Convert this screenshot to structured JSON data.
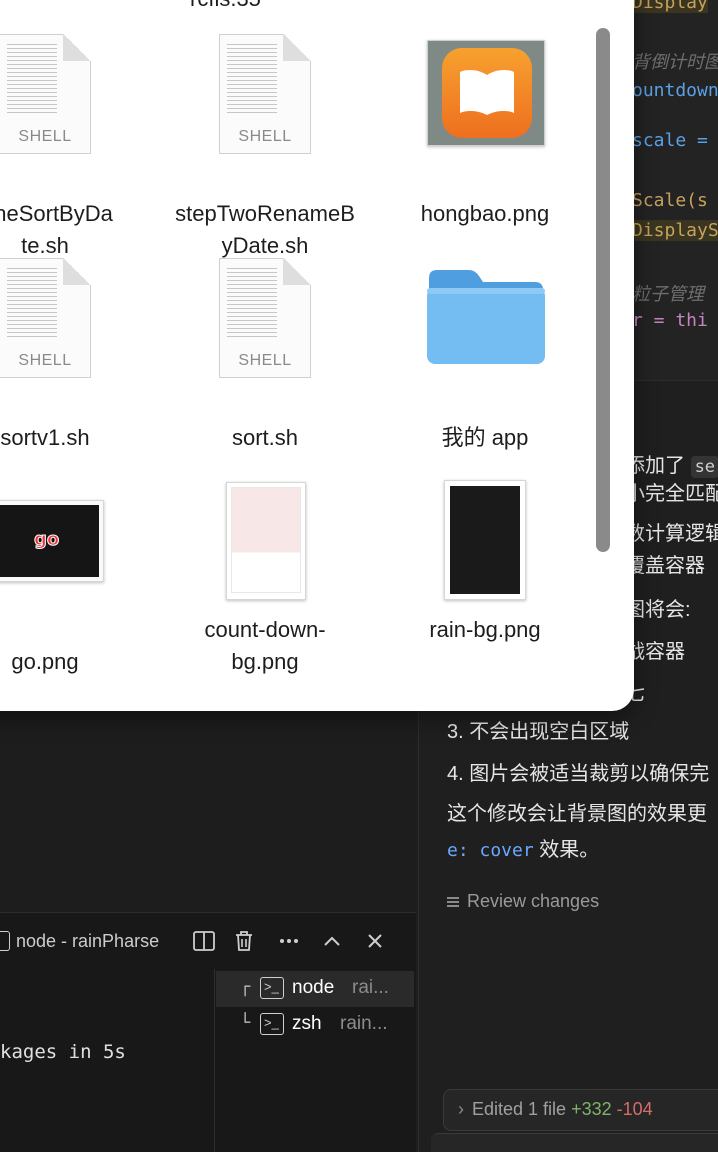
{
  "finder": {
    "top_partial_label": "rcfis.35",
    "items": [
      {
        "label_line1": "OneSortByDa",
        "label_line2": "te.sh",
        "icon": "shell-document-icon",
        "tag": "SHELL"
      },
      {
        "label_line1": "stepTwoRenameB",
        "label_line2": "yDate.sh",
        "icon": "shell-document-icon",
        "tag": "SHELL"
      },
      {
        "label_line1": "hongbao.png",
        "label_line2": "",
        "icon": "book-app-icon"
      },
      {
        "label_line1": "sortv1.sh",
        "label_line2": "",
        "icon": "shell-document-icon",
        "tag": "SHELL"
      },
      {
        "label_line1": "sort.sh",
        "label_line2": "",
        "icon": "shell-document-icon",
        "tag": "SHELL"
      },
      {
        "label_line1": "我的 app",
        "label_line2": "",
        "icon": "folder-icon"
      },
      {
        "label_line1": "go.png",
        "label_line2": "",
        "icon": "go-image-thumbnail",
        "thumb_text": "go"
      },
      {
        "label_line1": "count-down-",
        "label_line2": "bg.png",
        "icon": "image-thumbnail"
      },
      {
        "label_line1": "rain-bg.png",
        "label_line2": "",
        "icon": "image-thumbnail"
      }
    ],
    "accent_colors": {
      "book_orange": "#f07d26",
      "folder_blue": "#6fb8f0",
      "go_red": "#e8353b"
    }
  },
  "editor": {
    "lines": [
      {
        "text": "Display",
        "style": "yellow"
      },
      {
        "text": "背倒计时图",
        "style": "comment"
      },
      {
        "text": "ountdown",
        "style": "blue"
      },
      {
        "text": "scale =",
        "style": "blue"
      },
      {
        "text": "Scale(s",
        "style": "yellow"
      },
      {
        "text": "DisplayS",
        "style": "yellow"
      },
      {
        "text": "粒子管理",
        "style": "comment"
      },
      {
        "text": "r = thi",
        "style": "mixed"
      }
    ]
  },
  "chat": {
    "lines": [
      {
        "text": "添加了",
        "chip": "se"
      },
      {
        "text": "小完全匹配"
      },
      {
        "text": "数计算逻辑"
      },
      {
        "text": "覆盖容器"
      },
      {
        "text": "图将会:"
      },
      {
        "text": "战容器"
      },
      {
        "text": "七"
      },
      {
        "text": "3. 不会出现空白区域"
      },
      {
        "text": "4. 图片会被适当裁剪以确保完"
      },
      {
        "text": "这个修改会让背景图的效果更"
      }
    ],
    "last_line_code": "e: cover",
    "last_line_text": " 效果。",
    "review_label": "Review changes",
    "edited_label": "Edited 1 file",
    "edited_add": "+332",
    "edited_del": "-104"
  },
  "terminal": {
    "title": "node - rainPharse",
    "output": "kages in 5s",
    "sessions": [
      {
        "tree": "┌",
        "name": "node",
        "sub": "rai...",
        "active": true
      },
      {
        "tree": "└",
        "name": "zsh",
        "sub": "rain...",
        "active": false
      }
    ]
  }
}
